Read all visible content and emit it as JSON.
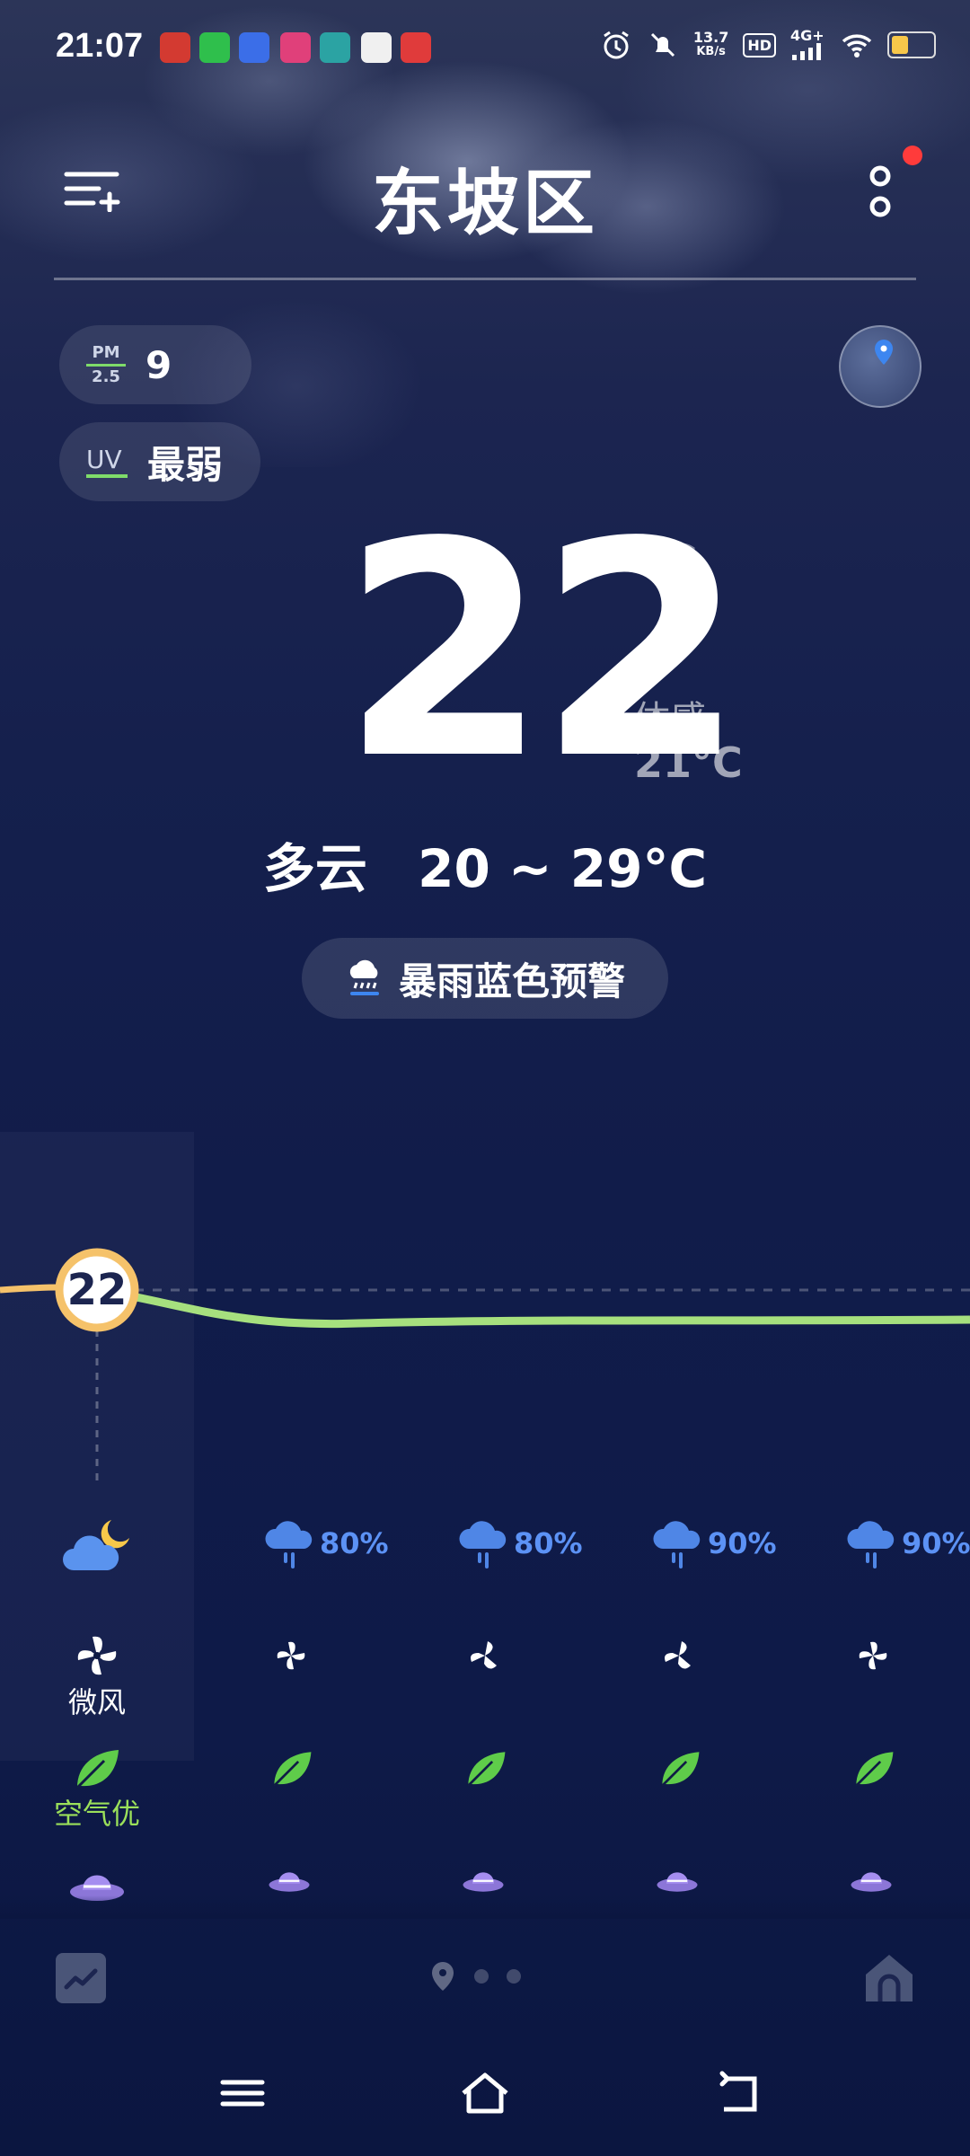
{
  "status_bar": {
    "time": "21:07",
    "net_speed": "13.7",
    "net_unit": "KB/s",
    "hd": "HD",
    "signal": "4G+",
    "notification_apps": [
      "netease-music-icon",
      "iqiyi-icon",
      "baidu-icon",
      "lofter-icon",
      "radio-icon",
      "58-icon",
      "taobao-icon"
    ]
  },
  "header": {
    "city": "东坡区"
  },
  "air": {
    "pm_label_top": "PM",
    "pm_label_bottom": "2.5",
    "pm_value": "9",
    "uv_label": "UV",
    "uv_value": "最弱"
  },
  "current": {
    "temperature": "22",
    "unit": "°C",
    "feels_label": "体感",
    "feels_value": "21°C",
    "condition": "多云",
    "range": "20 ~ 29°C",
    "alert": "暴雨蓝色预警"
  },
  "hourly": {
    "current_temp_badge": "22",
    "precip": [
      "80%",
      "80%",
      "90%",
      "90%"
    ],
    "wind_label": "微风",
    "air_label": "空气优"
  },
  "colors": {
    "curve_green": "#a6e07e",
    "curve_orange": "#f5c26a",
    "precip_blue": "#5c92f5",
    "air_green": "#9be05a",
    "hat_purple": "#8c76d8"
  }
}
